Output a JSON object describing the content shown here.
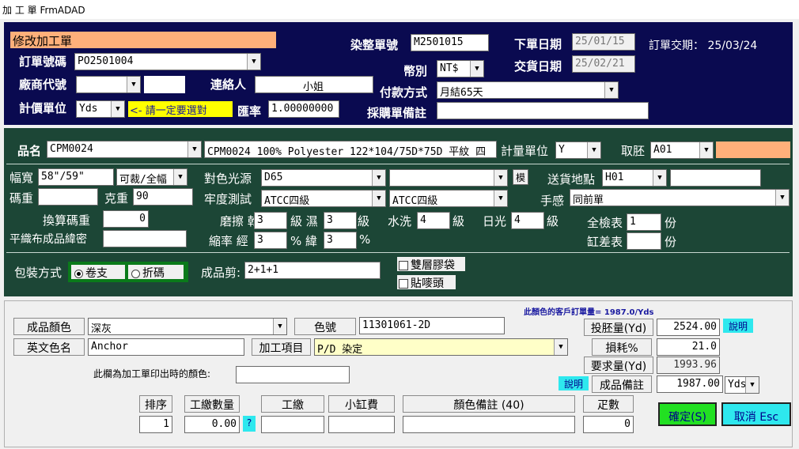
{
  "window": {
    "title": "加 工 單 FrmADAD"
  },
  "header": {
    "mode_title": "修改加工單",
    "order_no_label": "訂單號碼",
    "order_no": "PO2501004",
    "vendor_label": "廠商代號",
    "vendor_code": "",
    "contact_label": "連絡人",
    "contact": "小姐",
    "price_unit_label": "計價單位",
    "price_unit": "Yds",
    "price_unit_note": "<- 請一定要選對",
    "rate_label": "匯率",
    "rate": "1.00000000",
    "dye_no_label": "染整單號",
    "dye_no": "M2501015",
    "currency_label": "幣別",
    "currency": "NT$",
    "pay_label": "付款方式",
    "pay": "月結65天",
    "po_note_label": "採購單備註",
    "po_note": "",
    "order_date_label": "下單日期",
    "order_date": "25/01/15",
    "delivery_date_label": "交貨日期",
    "delivery_date": "25/02/21",
    "order_delivery": "訂單交期： 25/03/24"
  },
  "product": {
    "name_label": "品名",
    "code": "CPM0024",
    "desc": "CPM0024 100% Polyester 122*104/75D*75D 平紋 四",
    "qty_unit_label": "計量單位",
    "qty_unit": "Y",
    "embryo_label": "取胚",
    "embryo": "A01",
    "width_label": "幅寬",
    "width": "58\"/59\"",
    "cut": "可裁/全幅",
    "yard_weight_label": "碼重",
    "yard_weight": "",
    "gram_label": "克重",
    "gram": "90",
    "convert_label": "換算碼重",
    "convert": "0",
    "density_label": "平織布成品緯密",
    "density": "",
    "light_label": "對色光源",
    "light": "D65",
    "light2": "",
    "model_btn": "模",
    "fast_label": "牢度測試",
    "fast1": "ATCC四級",
    "fast2": "ATCC四級",
    "rub_label": "磨擦 乾",
    "rub_dry": "3",
    "rub_wet_label": "級 濕",
    "rub_wet": "3",
    "level": "級",
    "wash_label": "水洗",
    "wash": "4",
    "sun_label": "日光",
    "sun": "4",
    "shrink_label": "縮率 經",
    "shrink_warp": "3",
    "shrink_weft_label": "% 緯",
    "shrink_weft": "3",
    "pct": "%",
    "ship_label": "送貨地點",
    "ship_code": "H01",
    "ship_name": "",
    "hand_label": "手感",
    "hand": "同前單",
    "inspect_label": "全檢表",
    "inspect": "1",
    "copies": "份",
    "vat_label": "缸差表",
    "vat": "",
    "pack_label": "包裝方式",
    "pack_roll": "卷支",
    "pack_fold": "折碼",
    "cut_label": "成品剪:",
    "cut_value": "2+1+1",
    "double_bag": "雙層膠袋",
    "sticker": "貼嘜頭"
  },
  "color": {
    "customer_qty": "此顏色的客戶訂單量= 1987.0/Yds",
    "color_label": "成品顏色",
    "color": "深灰",
    "no_label": "色號",
    "no": "11301061-2D",
    "en_label": "英文色名",
    "en": "Anchor",
    "process_label": "加工項目",
    "process": "P/D 染定",
    "print_label": "此欄為加工單印出時的顏色:",
    "print": "",
    "embryo_qty_label": "投胚量(Yd)",
    "embryo_qty": "2524.00",
    "explain": "說明",
    "loss_label": "損耗%",
    "loss": "21.0",
    "req_label": "要求量(Yd)",
    "req": "1993.96",
    "finish_label": "成品備註",
    "finish": "1987.00",
    "finish_unit": "Yds"
  },
  "table": {
    "headers": [
      "排序",
      "工繳數量",
      "工繳",
      "小缸費",
      "顏色備註 (40)",
      "疋數"
    ],
    "row": {
      "seq": "1",
      "qty": "0.00",
      "q": "?",
      "fee": "",
      "vat_fee": "",
      "note": "",
      "count": "0"
    }
  },
  "buttons": {
    "ok": "確定(S)",
    "cancel": "取消 Esc"
  },
  "colors": {
    "navy": "#0a0a50",
    "green": "#1c4636",
    "orange": "#ffb07a",
    "cyan": "#2ee8ee",
    "ok": "#22e022"
  }
}
